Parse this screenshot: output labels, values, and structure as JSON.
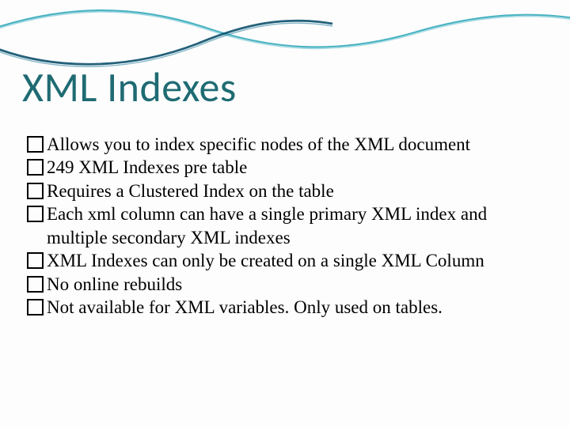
{
  "slide": {
    "title": "XML Indexes",
    "bullets": [
      "Allows you to index specific nodes of the XML document",
      " 249 XML Indexes pre table",
      "Requires a Clustered Index on the table",
      "Each xml column can have a single primary XML index and multiple secondary XML indexes",
      "XML Indexes can only be created on a single XML Column",
      "No online rebuilds",
      "Not available for XML variables. Only used on tables."
    ]
  }
}
